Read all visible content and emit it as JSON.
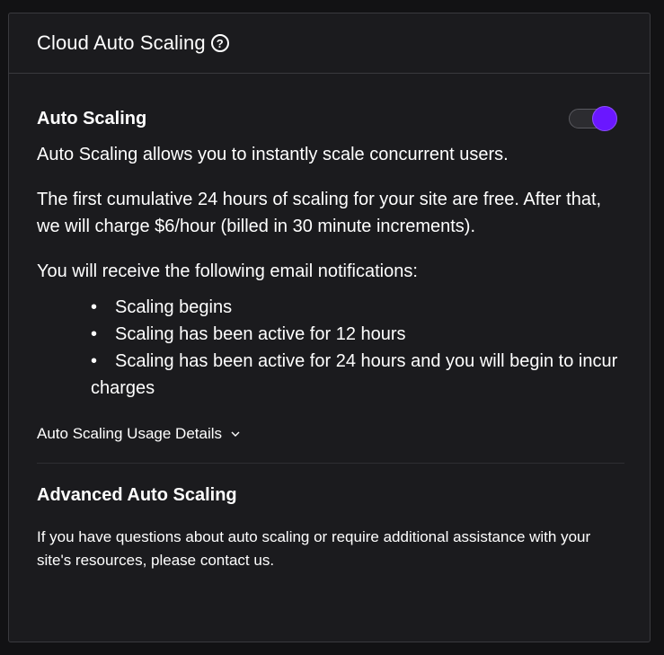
{
  "header": {
    "title": "Cloud Auto Scaling",
    "help_icon": "question-circle-icon"
  },
  "auto_scaling": {
    "title": "Auto Scaling",
    "toggle_on": true,
    "toggle_color": "#6a17ff",
    "description": "Auto Scaling allows you to instantly scale concurrent users.",
    "pricing": "The first cumulative 24 hours of scaling for your site are free. After that, we will charge $6/hour (billed in 30 minute increments).",
    "notifications_intro": "You will receive the following email notifications:",
    "notifications": [
      "Scaling begins",
      "Scaling has been active for 12 hours",
      "Scaling has been active for 24 hours and you will begin to incur charges"
    ],
    "bullet": "•",
    "details_link": "Auto Scaling Usage Details",
    "details_icon": "chevron-down-icon"
  },
  "advanced": {
    "title": "Advanced Auto Scaling",
    "text": "If you have questions about auto scaling or require additional assistance with your site's resources, please contact us."
  }
}
